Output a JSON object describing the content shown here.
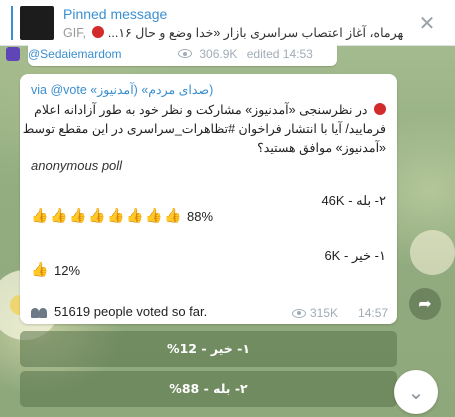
{
  "pinned": {
    "title": "Pinned message",
    "preview_prefix": "GIF, ",
    "preview_text": "...مهرماه، آغاز اعتصاب سراسری بازار  «خدا وضع و حال ۱۶"
  },
  "previous_message": {
    "handle": "@Sedaiemardom",
    "views": "306.9K",
    "edited": "edited 14:53"
  },
  "message": {
    "via": "(صدای مردم» (آمدنیوز» via @vote",
    "question_lines": [
      "در نظرسنجی «آمدنیوز» مشارکت و نظر خود به طور آزادانه اعلام",
      "فرمایید/ آیا با انتشار فراخوان #تظاهرات_سراسری در این مقطع توسط",
      "«آمدنیوز» موافق هستید؟"
    ],
    "poll_type": "anonymous poll",
    "options": [
      {
        "label": "۲- بله",
        "votes": "46K",
        "percent": "88%",
        "thumbs": 8
      },
      {
        "label": "۱- خیر",
        "votes": "6K",
        "percent": "12%",
        "thumbs": 1
      }
    ],
    "voters_text": "51619 people voted so far.",
    "views": "315K",
    "time": "14:57"
  },
  "buttons": [
    {
      "label": "۱- خیر - 12%"
    },
    {
      "label": "۲- بله - 88%"
    }
  ],
  "icons": {
    "close": "close-icon",
    "share": "share-icon",
    "scroll_down": "chevron-down-icon",
    "thumb": "thumbs-up-icon",
    "people": "people-icon",
    "eye": "eye-icon"
  },
  "colors": {
    "accent": "#3a8fd0",
    "red_dot": "#d12b2b",
    "thumb": "#f0b43a"
  }
}
